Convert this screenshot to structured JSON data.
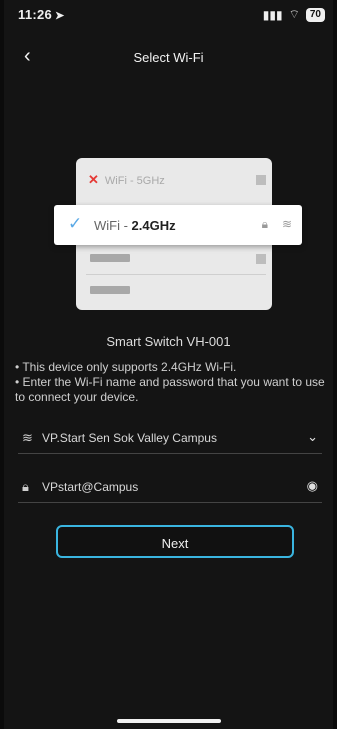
{
  "status": {
    "time": "11:26",
    "signal": "::!!",
    "wifi": "wifi-icon",
    "battery": "70"
  },
  "header": {
    "title": "Select Wi-Fi",
    "back": "chevron-left-icon"
  },
  "illustration": {
    "rejected_network": "WiFi - 5GHz",
    "selected_prefix": "WiFi - ",
    "selected_band": "2.4GHz"
  },
  "device": {
    "name": "Smart Switch VH-001",
    "note_line1": "• This device only supports 2.4GHz Wi-Fi.",
    "note_line2": "• Enter the Wi-Fi name and password that you want to use to connect your device."
  },
  "form": {
    "ssid_value": "VP.Start Sen Sok Valley Campus",
    "password_value": "VPstart@Campus"
  },
  "actions": {
    "next_label": "Next"
  },
  "colors": {
    "accent": "#3ab5e0",
    "error": "#e53935",
    "check": "#5aa9e6"
  }
}
